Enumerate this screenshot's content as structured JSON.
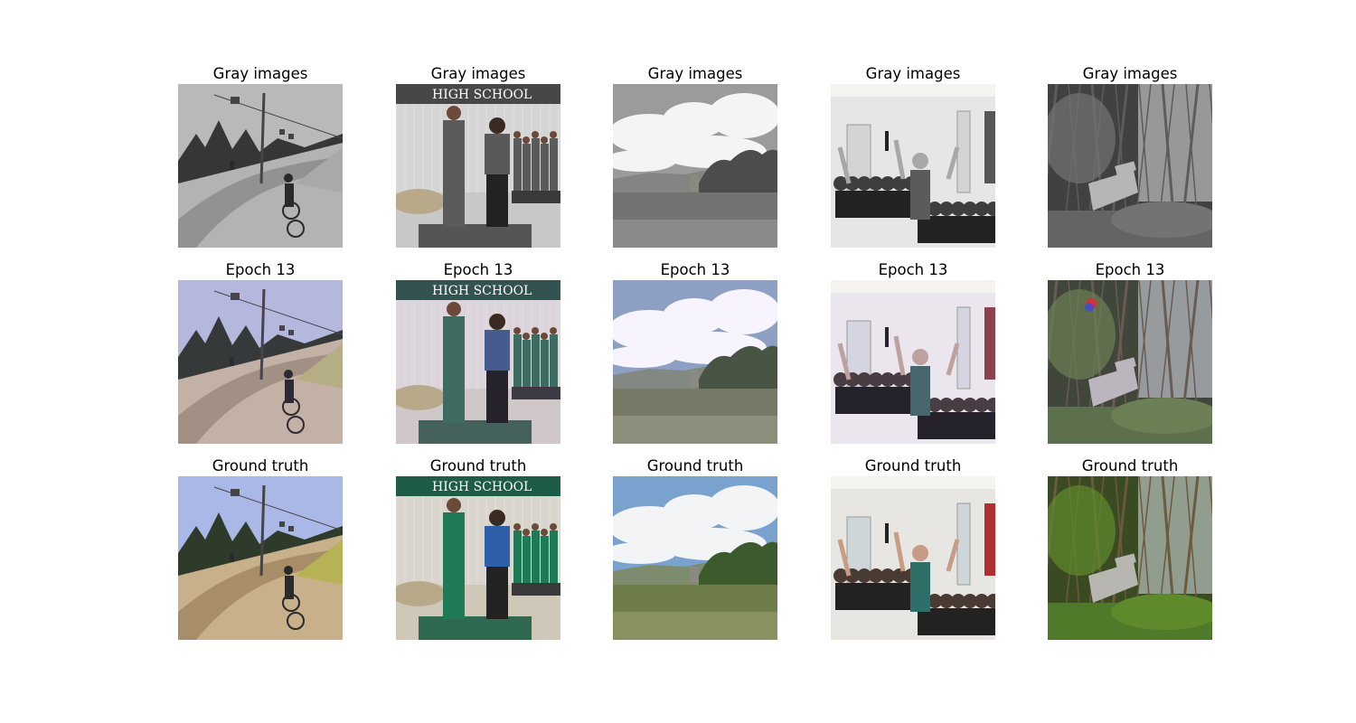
{
  "grid": {
    "rows": [
      {
        "title": "Gray images"
      },
      {
        "title": "Epoch 13"
      },
      {
        "title": "Ground truth"
      }
    ],
    "scenes": [
      {
        "name": "mountain-bike-trail"
      },
      {
        "name": "graduation-ceremony",
        "banner_text": "HIGH SCHOOL"
      },
      {
        "name": "cloudy-countryside"
      },
      {
        "name": "classroom-crowd"
      },
      {
        "name": "forest-abandoned-object"
      }
    ]
  },
  "colors": {
    "background": "#ffffff",
    "text": "#000000"
  }
}
